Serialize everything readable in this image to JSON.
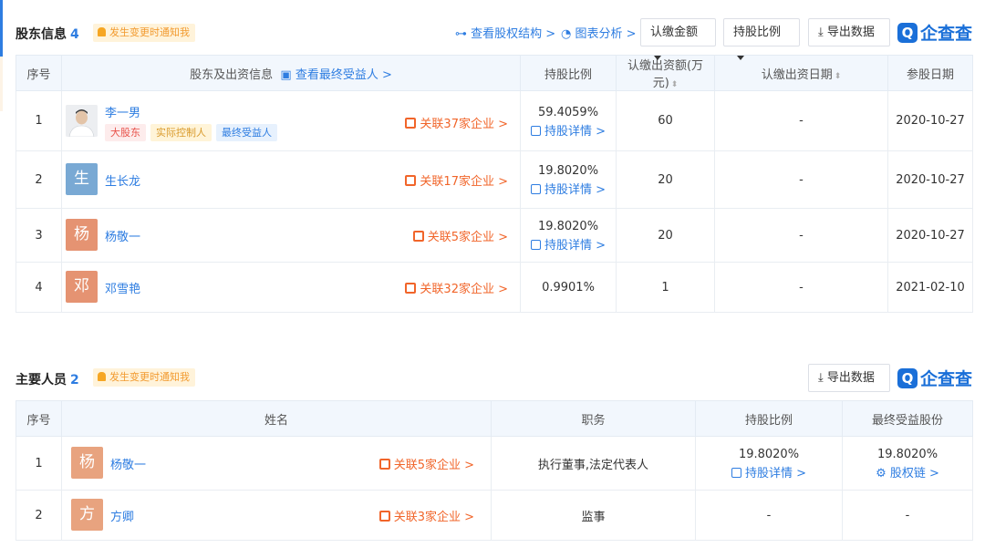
{
  "shareholders": {
    "title": "股东信息",
    "count": "4",
    "notify": "发生变更时通知我",
    "links": {
      "equity_structure": "查看股权结构 >",
      "chart_analysis": "图表分析 >"
    },
    "buttons": {
      "subscribed_amount": "认缴金额",
      "share_ratio": "持股比例",
      "export": "导出数据"
    },
    "logo": "企查查",
    "columns": {
      "index": "序号",
      "info": "股东及出资信息",
      "beneficiary_link": "查看最终受益人 >",
      "ratio": "持股比例",
      "amount": "认缴出资额(万元)",
      "date_sub": "认缴出资日期",
      "join_date": "参股日期"
    },
    "rows": [
      {
        "index": "1",
        "name": "李一男",
        "avatar": "",
        "tags": [
          "大股东",
          "实际控制人",
          "最终受益人"
        ],
        "related": "关联37家企业 >",
        "ratio": "59.4059%",
        "detail": "持股详情 >",
        "amount": "60",
        "sub_date": "-",
        "join_date": "2020-10-27"
      },
      {
        "index": "2",
        "name": "生长龙",
        "avatar": "生",
        "tags": [],
        "related": "关联17家企业 >",
        "ratio": "19.8020%",
        "detail": "持股详情 >",
        "amount": "20",
        "sub_date": "-",
        "join_date": "2020-10-27"
      },
      {
        "index": "3",
        "name": "杨敬一",
        "avatar": "杨",
        "tags": [],
        "related": "关联5家企业 >",
        "ratio": "19.8020%",
        "detail": "持股详情 >",
        "amount": "20",
        "sub_date": "-",
        "join_date": "2020-10-27"
      },
      {
        "index": "4",
        "name": "邓雪艳",
        "avatar": "邓",
        "tags": [],
        "related": "关联32家企业 >",
        "ratio": "0.9901%",
        "detail": "",
        "amount": "1",
        "sub_date": "-",
        "join_date": "2021-02-10"
      }
    ]
  },
  "personnel": {
    "title": "主要人员",
    "count": "2",
    "notify": "发生变更时通知我",
    "export": "导出数据",
    "logo": "企查查",
    "columns": {
      "index": "序号",
      "name": "姓名",
      "position": "职务",
      "ratio": "持股比例",
      "final_share": "最终受益股份"
    },
    "rows": [
      {
        "index": "1",
        "name": "杨敬一",
        "avatar": "杨",
        "related": "关联5家企业 >",
        "position": "执行董事,法定代表人",
        "ratio": "19.8020%",
        "ratio_link": "持股详情 >",
        "final": "19.8020%",
        "final_link": "股权链 >"
      },
      {
        "index": "2",
        "name": "方卿",
        "avatar": "方",
        "related": "关联3家企业 >",
        "position": "监事",
        "ratio": "-",
        "ratio_link": "",
        "final": "-",
        "final_link": ""
      }
    ]
  }
}
